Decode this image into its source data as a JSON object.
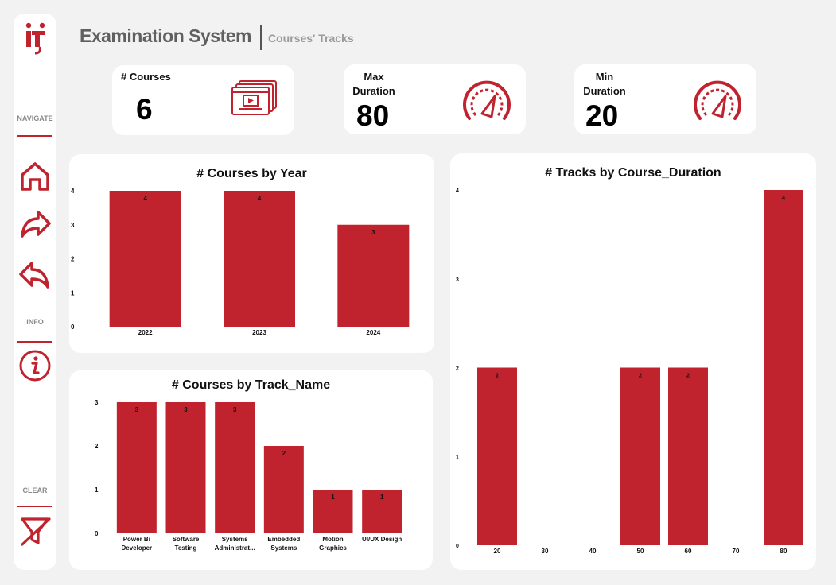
{
  "header": {
    "title": "Examination System",
    "subtitle": "Courses' Tracks"
  },
  "sidebar": {
    "logo": "iti-logo",
    "navigate_label": "NAVIGATE",
    "info_label": "INFO",
    "clear_label": "CLEAR",
    "icons": [
      "home-icon",
      "forward-arrow-icon",
      "back-arrow-icon",
      "info-icon",
      "clear-filter-icon"
    ]
  },
  "kpis": {
    "courses": {
      "label": "# Courses",
      "value": "6",
      "icon": "video-course-icon"
    },
    "max": {
      "label": "Max\nDuration",
      "value": "80",
      "icon": "gauge-icon"
    },
    "min": {
      "label": "Min\nDuration",
      "value": "20",
      "icon": "gauge-icon"
    }
  },
  "colors": {
    "accent": "#c0232e",
    "bar": "#c1232e",
    "background": "#f2f2f2",
    "card": "#ffffff"
  },
  "chart_data": [
    {
      "type": "bar",
      "title": "# Courses by Year",
      "categories": [
        "2022",
        "2023",
        "2024"
      ],
      "values": [
        4,
        4,
        3
      ],
      "ylim": [
        0,
        4
      ],
      "yticks": [
        0,
        1,
        2,
        3,
        4
      ]
    },
    {
      "type": "bar",
      "title": "# Courses by Track_Name",
      "categories": [
        [
          "Power Bi",
          "Developer"
        ],
        [
          "Software",
          "Testing"
        ],
        [
          "Systems",
          "Administrat..."
        ],
        [
          "Embedded",
          "Systems"
        ],
        [
          "Motion",
          "Graphics"
        ],
        [
          "UI/UX Design"
        ]
      ],
      "values": [
        3,
        3,
        3,
        2,
        1,
        1
      ],
      "ylim": [
        0,
        3
      ],
      "yticks": [
        0,
        1,
        2,
        3
      ]
    },
    {
      "type": "bar",
      "title": "# Tracks by Course_Duration",
      "categories": [
        "20",
        "30",
        "40",
        "50",
        "60",
        "70",
        "80"
      ],
      "values": [
        2,
        null,
        null,
        2,
        2,
        null,
        4
      ],
      "ylim": [
        0,
        4
      ],
      "yticks": [
        0,
        1,
        2,
        3,
        4
      ]
    }
  ]
}
